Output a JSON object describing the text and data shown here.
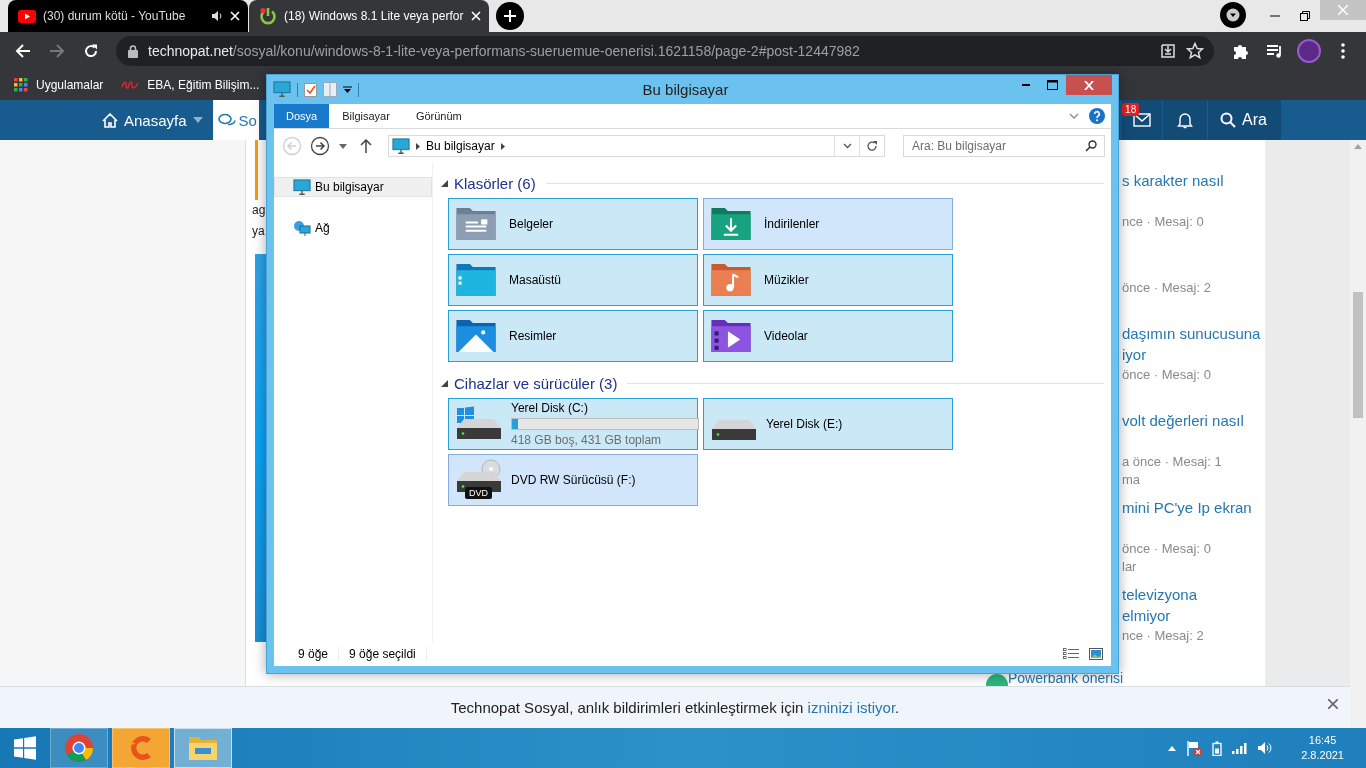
{
  "browser": {
    "tabs": [
      {
        "kind": "youtube",
        "title": "(30) durum kötü - YouTube",
        "selected": false,
        "audio": true
      },
      {
        "kind": "site",
        "title": "(18) Windows 8.1 Lite veya perfor",
        "selected": true,
        "audio": false
      }
    ],
    "address": {
      "host": "technopat.net",
      "path": "/sosyal/konu/windows-8-1-lite-veya-performans-sueruemue-oenerisi.1621158/page-2#post-12447982"
    },
    "bookmarks": [
      {
        "kind": "apps",
        "label": "Uygulamalar"
      },
      {
        "kind": "eba",
        "label": "EBA, Eğitim Bilişim..."
      }
    ]
  },
  "site": {
    "nav": [
      {
        "kind": "home",
        "label": "Anasayfa",
        "selected": false
      },
      {
        "kind": "chat",
        "label": "So",
        "selected": true
      }
    ],
    "inbox_badge": "18",
    "search_label": "Ara",
    "post_fragments": [
      "ag",
      "ya"
    ],
    "sidebar": [
      {
        "title_lines": [
          "s karakter nasıl"
        ],
        "meta": "nce · Mesaj: 0"
      },
      {
        "meta": "önce · Mesaj: 2"
      },
      {
        "title_lines": [
          "daşımın sunucusuna",
          "iyor"
        ],
        "meta": "önce · Mesaj: 0"
      },
      {
        "title_lines": [
          "volt değerleri nasıl"
        ],
        "meta": "a önce · Mesaj: 1",
        "tag": "ma"
      },
      {
        "title_lines": [
          "mini PC'ye Ip ekran"
        ],
        "meta": "önce · Mesaj: 0",
        "tag": "lar"
      },
      {
        "title_lines": [
          "televizyona",
          "elmiyor"
        ],
        "meta": "nce · Mesaj: 2"
      },
      {
        "title_lines": [
          "Powerbank önerisi"
        ],
        "avatar": true
      }
    ],
    "notice": {
      "text": "Technopat Sosyal, anlık bildirimleri etkinleştirmek için ",
      "link": "izninizi istiyor",
      "end": "."
    }
  },
  "explorer": {
    "title": "Bu bilgisayar",
    "ribbon_tabs": [
      {
        "label": "Dosya",
        "selected": true
      },
      {
        "label": "Bilgisayar",
        "selected": false
      },
      {
        "label": "Görünüm",
        "selected": false
      }
    ],
    "back_disabled": true,
    "path": [
      "Bu bilgisayar"
    ],
    "search_placeholder": "Ara: Bu bilgisayar",
    "nav": [
      {
        "kind": "pc",
        "label": "Bu bilgisayar",
        "selected": true
      },
      {
        "kind": "network",
        "label": "Ağ",
        "selected": false
      }
    ],
    "groups": [
      {
        "title": "Klasörler (6)",
        "expanded": true,
        "items": [
          {
            "kind": "documents",
            "label": "Belgeler",
            "selected": true,
            "hovered": false
          },
          {
            "kind": "downloads",
            "label": "İndirilenler",
            "selected": true,
            "hovered": true
          },
          {
            "kind": "desktop",
            "label": "Masaüstü",
            "selected": true,
            "hovered": false
          },
          {
            "kind": "music",
            "label": "Müzikler",
            "selected": true,
            "hovered": false
          },
          {
            "kind": "pictures",
            "label": "Resimler",
            "selected": true,
            "hovered": false
          },
          {
            "kind": "videos",
            "label": "Videolar",
            "selected": true,
            "hovered": false
          }
        ]
      },
      {
        "title": "Cihazlar ve sürücüler (3)",
        "expanded": true,
        "items": [
          {
            "kind": "system",
            "label": "Yerel Disk (C:)",
            "level": 0.03,
            "reading": "418 GB boş, 431 GB toplam",
            "selected": true,
            "hovered": false
          },
          {
            "kind": "disk",
            "label": "Yerel Disk (E:)",
            "selected": true,
            "hovered": false
          },
          {
            "kind": "dvd",
            "label": "DVD RW Sürücüsü (F:)",
            "badge": "DVD",
            "selected": true,
            "hovered": true
          }
        ]
      }
    ],
    "status": [
      "9 öğe",
      "9 öğe seçildi"
    ]
  },
  "taskbar": {
    "apps": [
      {
        "kind": "chrome",
        "selected": false,
        "flashing": false
      },
      {
        "kind": "orange",
        "selected": false,
        "flashing": true
      },
      {
        "kind": "explorer",
        "selected": true,
        "flashing": false
      }
    ],
    "time": "16:45",
    "date": "2.8.2021"
  }
}
